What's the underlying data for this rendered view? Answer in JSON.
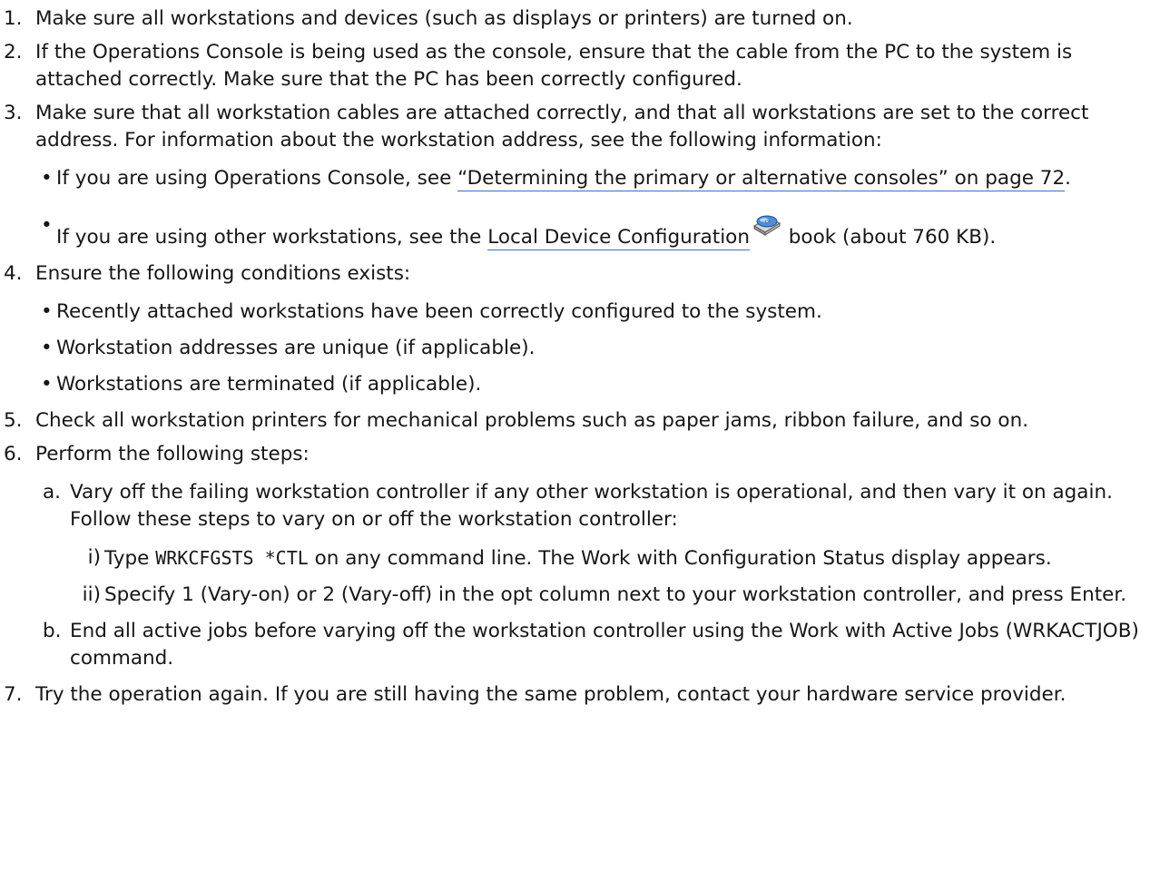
{
  "steps": [
    {
      "num": "1.",
      "text": "Make sure all workstations and devices (such as displays or printers) are turned on."
    },
    {
      "num": "2.",
      "text": "If the Operations Console is being used as the console, ensure that the cable from the PC to the system is attached correctly. Make sure that the PC has been correctly configured."
    },
    {
      "num": "3.",
      "text": "Make sure that all workstation cables are attached correctly, and that all workstations are set to the correct address. For information about the workstation address, see the following information:",
      "bullets": [
        {
          "pre": "If you are using Operations Console, see ",
          "link": "“Determining the primary or alternative consoles” on page 72",
          "post": "."
        },
        {
          "pre": "If you are using other workstations, see the ",
          "link": "Local Device Configuration",
          "icon": "book-cd-icon",
          "post": " book (about 760 KB)."
        }
      ]
    },
    {
      "num": "4.",
      "text": "Ensure the following conditions exists:",
      "bullets": [
        "Recently attached workstations have been correctly configured to the system.",
        "Workstation addresses are unique (if applicable).",
        "Workstations are terminated (if applicable)."
      ]
    },
    {
      "num": "5.",
      "text": "Check all workstation printers for mechanical problems such as paper jams, ribbon failure, and so on."
    },
    {
      "num": "6.",
      "text": "Perform the following steps:",
      "substeps": [
        {
          "label": "a.",
          "text": "Vary off the failing workstation controller if any other workstation is operational, and then vary it on again. Follow these steps to vary on or off the workstation controller:",
          "items": [
            {
              "label": "i)",
              "pre": "Type ",
              "code": "WRKCFGSTS *CTL",
              "post": " on any command line. The Work with Configuration Status display appears."
            },
            {
              "label": "ii)",
              "pre": "Specify 1 (Vary-on) or 2 (Vary-off) in the opt column next to your workstation controller, and press Enter."
            }
          ]
        },
        {
          "label": "b.",
          "text": "End all active jobs before varying off the workstation controller using the Work with Active Jobs (WRKACTJOB) command."
        }
      ]
    },
    {
      "num": "7.",
      "text": "Try the operation again. If you are still having the same problem, contact your hardware service provider."
    }
  ],
  "colors": {
    "text": "#161616",
    "link_underline": "#3b6fb6"
  }
}
